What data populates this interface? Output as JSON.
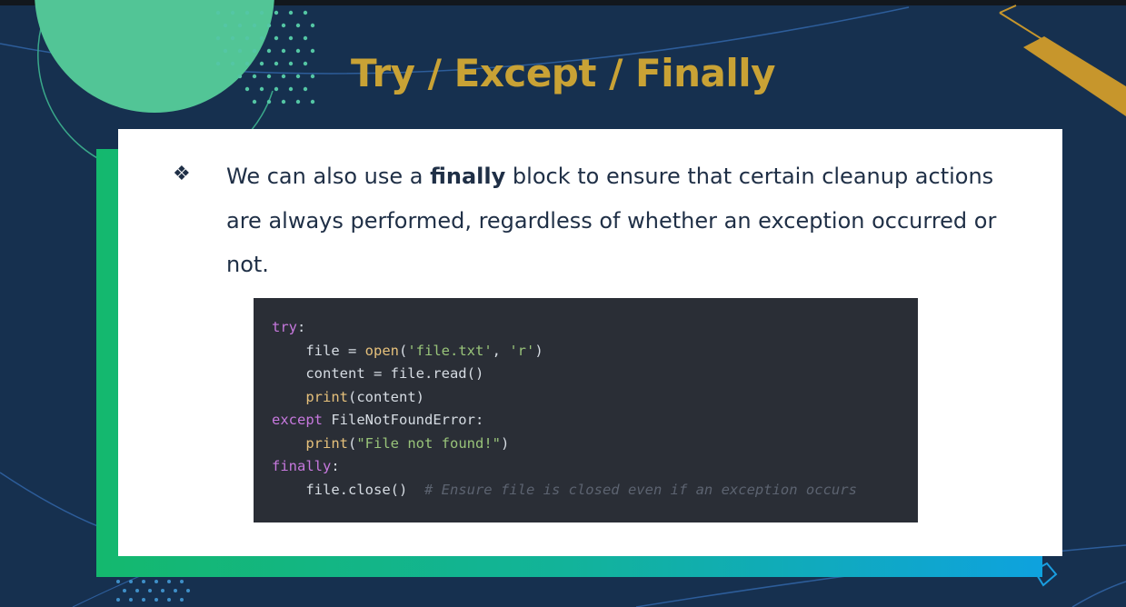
{
  "slide": {
    "title": "Try / Except / Finally",
    "bullet": {
      "symbol": "❖",
      "text_before": "We can also use a ",
      "text_bold": "finally",
      "text_after": " block to ensure that certain cleanup actions are always performed, regardless of whether an exception occurred or not."
    },
    "code": {
      "line1_kw": "try",
      "line1_rest": ":",
      "line2_indent": "    ",
      "line2_a": "file = ",
      "line2_fn": "open",
      "line2_b": "(",
      "line2_s1": "'file.txt'",
      "line2_c": ", ",
      "line2_s2": "'r'",
      "line2_d": ")",
      "line3": "    content = file.read()",
      "line4_indent": "    ",
      "line4_fn": "print",
      "line4_rest": "(content)",
      "line5_kw": "except",
      "line5_rest": " FileNotFoundError:",
      "line6_indent": "    ",
      "line6_fn": "print",
      "line6_a": "(",
      "line6_str": "\"File not found!\"",
      "line6_b": ")",
      "line7_kw": "finally",
      "line7_rest": ":",
      "line8_code": "    file.close()  ",
      "line8_comment": "# Ensure file is closed even if an exception occurs"
    }
  },
  "colors": {
    "background": "#16304f",
    "title": "#c9a235",
    "body_text": "#1f2f46",
    "code_background": "#2a2e36",
    "keyword": "#c678dd",
    "function": "#e5c07b",
    "string": "#98c379",
    "comment": "#5c6370",
    "gradient_start": "#14b86e",
    "gradient_end": "#0ea2de",
    "circle": "#52c596",
    "gold_accent": "#c7962c"
  }
}
